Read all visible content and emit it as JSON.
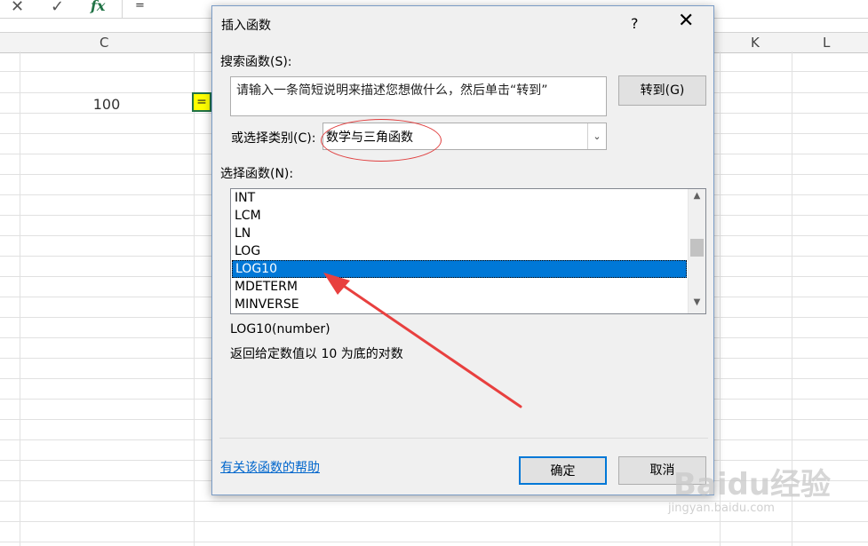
{
  "formula_bar": {
    "cancel_icon": "✕",
    "confirm_icon": "✓",
    "fx_label": "fx",
    "formula_text": "="
  },
  "sheet": {
    "columns": [
      "C",
      "K",
      "L"
    ],
    "cell_c_value": "100",
    "active_cell_text": "="
  },
  "dialog": {
    "title": "插入函数",
    "help_button": "?",
    "close_button": "✕",
    "search_label": "搜索函数(S):",
    "search_text": "请输入一条简短说明来描述您想做什么，然后单击“转到”",
    "goto_button": "转到(G)",
    "category_label": "或选择类别(C):",
    "category_value": "数学与三角函数",
    "select_label": "选择函数(N):",
    "functions": [
      "INT",
      "LCM",
      "LN",
      "LOG",
      "LOG10",
      "MDETERM",
      "MINVERSE"
    ],
    "selected_function": "LOG10",
    "signature": "LOG10(number)",
    "description": "返回给定数值以 10 为底的对数",
    "help_link": "有关该函数的帮助",
    "ok_button": "确定",
    "cancel_button": "取消"
  },
  "annotation_color": "#e8403f",
  "accent_color": "#0078d7",
  "watermark": {
    "text": "Baidu经验",
    "subtext": "jingyan.baidu.com"
  }
}
